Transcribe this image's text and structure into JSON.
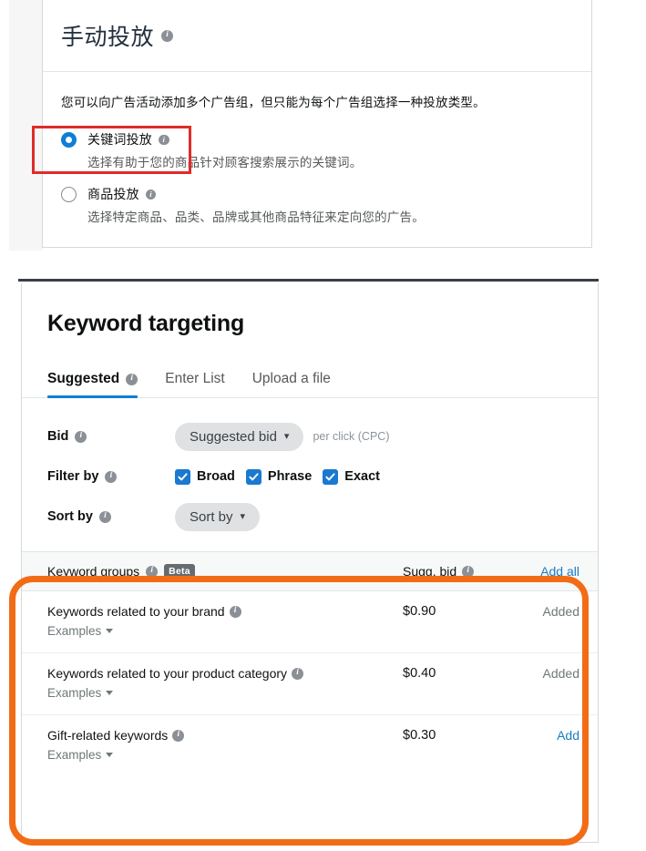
{
  "manual_targeting": {
    "title": "手动投放",
    "title_info_icon": "info-icon",
    "intro": "您可以向广告活动添加多个广告组，但只能为每个广告组选择一种投放类型。",
    "options": [
      {
        "label": "关键词投放",
        "description": "选择有助于您的商品针对顾客搜索展示的关键词。",
        "selected": true,
        "info_icon": "info-icon"
      },
      {
        "label": "商品投放",
        "description": "选择特定商品、品类、品牌或其他商品特征来定向您的广告。",
        "selected": false,
        "info_icon": "info-icon"
      }
    ]
  },
  "keyword_targeting": {
    "title": "Keyword targeting",
    "tabs": [
      {
        "label": "Suggested",
        "active": true,
        "info_icon": "info-icon"
      },
      {
        "label": "Enter List",
        "active": false
      },
      {
        "label": "Upload a file",
        "active": false
      }
    ],
    "bid": {
      "label": "Bid",
      "dropdown_value": "Suggested bid",
      "note": "per click (CPC)",
      "info_icon": "info-icon",
      "chevron": "chevron-down-icon"
    },
    "filter_by": {
      "label": "Filter by",
      "info_icon": "info-icon",
      "options": [
        {
          "label": "Broad",
          "checked": true
        },
        {
          "label": "Phrase",
          "checked": true
        },
        {
          "label": "Exact",
          "checked": true
        }
      ]
    },
    "sort_by": {
      "label": "Sort by",
      "dropdown_value": "Sort by",
      "info_icon": "info-icon",
      "chevron": "chevron-down-icon"
    },
    "table": {
      "headers": {
        "name": "Keyword groups",
        "badge": "Beta",
        "bid": "Sugg. bid",
        "action": "Add all"
      },
      "rows": [
        {
          "name": "Keywords related to your brand",
          "examples": "Examples",
          "bid": "$0.90",
          "action": "Added",
          "action_state": "added"
        },
        {
          "name": "Keywords related to your product category",
          "examples": "Examples",
          "bid": "$0.40",
          "action": "Added",
          "action_state": "added"
        },
        {
          "name": "Gift-related keywords",
          "examples": "Examples",
          "bid": "$0.30",
          "action": "Add",
          "action_state": "add"
        }
      ]
    }
  },
  "annotations": {
    "red_box_color": "#e02b2b",
    "orange_box_color": "#f26c16"
  },
  "colors": {
    "accent_blue": "#0f7fd4",
    "link_blue": "#187dc4",
    "checkbox_blue": "#1a79d0",
    "badge_gray": "#656b70"
  }
}
